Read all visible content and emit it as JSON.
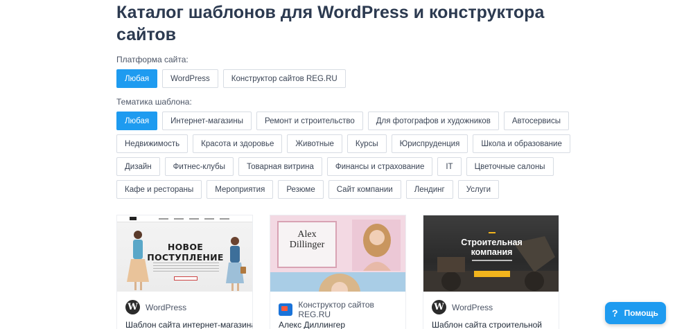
{
  "page": {
    "title": "Каталог шаблонов для WordPress и конструктора сайтов"
  },
  "filters": {
    "platform": {
      "label": "Платформа сайта:",
      "options": [
        "Любая",
        "WordPress",
        "Конструктор сайтов REG.RU"
      ],
      "selected": "Любая"
    },
    "theme": {
      "label": "Тематика шаблона:",
      "rows": [
        [
          "Любая",
          "Интернет-магазины",
          "Ремонт и строительство",
          "Для фотографов и художников",
          "Автосервисы"
        ],
        [
          "Недвижимость",
          "Красота и здоровье",
          "Животные",
          "Курсы",
          "Юриспруденция",
          "Школа и образование"
        ],
        [
          "Дизайн",
          "Фитнес-клубы",
          "Товарная витрина",
          "Финансы и страхование",
          "IT",
          "Цветочные салоны"
        ],
        [
          "Кафе и рестораны",
          "Мероприятия",
          "Резюме",
          "Сайт компании",
          "Лендинг",
          "Услуги"
        ]
      ],
      "selected": "Любая"
    }
  },
  "cards": [
    {
      "platform": "WordPress",
      "platform_icon": "wordpress-icon",
      "name": "Шаблон сайта интернет-магазина",
      "preview": {
        "headline_1": "НОВОЕ",
        "headline_2": "ПОСТУПЛЕНИЕ"
      }
    },
    {
      "platform": "Конструктор сайтов REG.RU",
      "platform_icon": "reg-ru-icon",
      "name": "Алекс Диллингер",
      "preview": {
        "name_line_1": "Alex",
        "name_line_2": "Dillinger"
      }
    },
    {
      "platform": "WordPress",
      "platform_icon": "wordpress-icon",
      "name": "Шаблон сайта строительной",
      "preview": {
        "headline_1": "Строительная",
        "headline_2": "компания"
      }
    }
  ],
  "help": {
    "label": "Помощь",
    "icon": "question-icon"
  },
  "colors": {
    "accent": "#1e9bf0",
    "title": "#2c3a50",
    "border": "#d7dce3"
  }
}
